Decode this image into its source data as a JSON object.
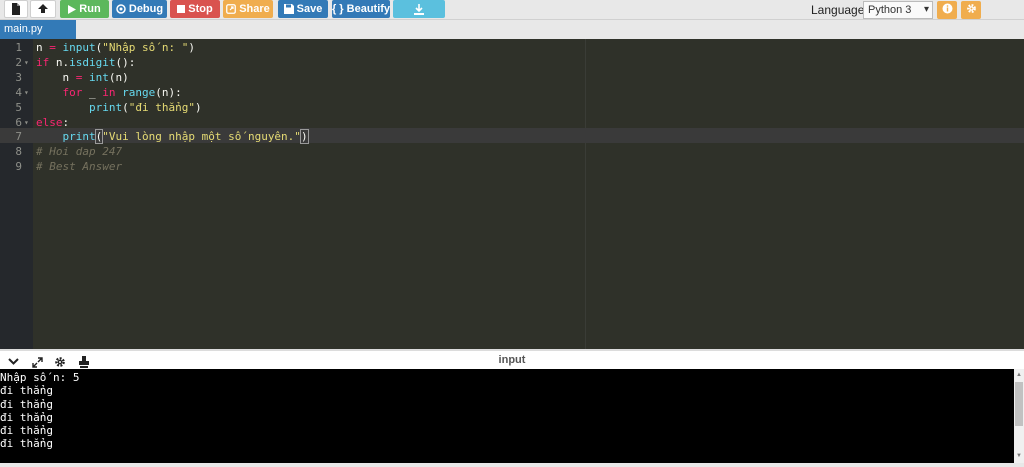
{
  "toolbar": {
    "new_file_icon": "file-icon",
    "upload_icon": "upload-icon",
    "run_label": "Run",
    "debug_label": "Debug",
    "stop_label": "Stop",
    "share_label": "Share",
    "save_label": "Save",
    "beautify_label": "{ } Beautify",
    "download_icon": "download-icon",
    "language_label": "Language",
    "language_value": "Python 3",
    "colors": {
      "run": "#5cb85c",
      "debug": "#337ab7",
      "stop": "#d9534f",
      "share": "#f0ad4e",
      "save": "#337ab7",
      "beautify": "#5bc0de",
      "download": "#5bc0de"
    }
  },
  "tabs": [
    {
      "label": "main.py",
      "active": true
    }
  ],
  "editor": {
    "theme": "dark",
    "lines": [
      {
        "number": "1",
        "text": "n = input(\"Nhập số n: \")"
      },
      {
        "number": "2",
        "text": "if n.isdigit():"
      },
      {
        "number": "3",
        "text": "    n = int(n)"
      },
      {
        "number": "4",
        "text": "    for _ in range(n):"
      },
      {
        "number": "5",
        "text": "        print(\"đi thẳng\")"
      },
      {
        "number": "6",
        "text": "else:"
      },
      {
        "number": "7",
        "text": "    print(\"Vui lòng nhập một số nguyên.\")"
      },
      {
        "number": "8",
        "text": "# Hoi dap 247"
      },
      {
        "number": "9",
        "text": "# Best Answer"
      }
    ],
    "fold_markers": [
      "2",
      "4",
      "6"
    ],
    "active_line": "7"
  },
  "console": {
    "title": "input",
    "icons": [
      "chevron-down-icon",
      "expand-icon",
      "gear-icon",
      "stamp-icon"
    ],
    "output": [
      "Nhập số n: 5",
      "đi thẳng",
      "đi thẳng",
      "đi thẳng",
      "đi thẳng",
      "đi thẳng"
    ]
  }
}
